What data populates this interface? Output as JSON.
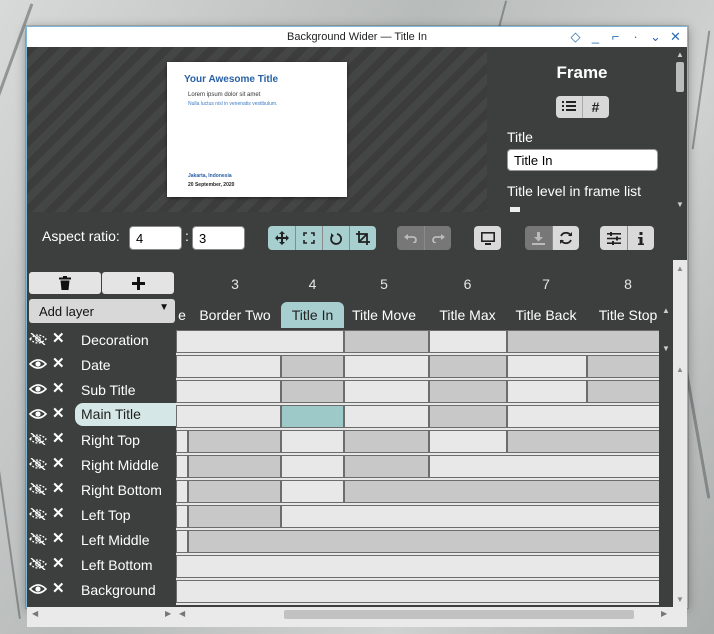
{
  "window": {
    "title": "Background Wider — Title In"
  },
  "wm_buttons": [
    {
      "name": "shade-icon",
      "glyph": "◇"
    },
    {
      "name": "minimize-icon",
      "glyph": "_"
    },
    {
      "name": "maximize-icon",
      "glyph": "⌐"
    },
    {
      "name": "sticky-icon",
      "glyph": "·"
    },
    {
      "name": "chevron-down-icon",
      "glyph": "⌄"
    },
    {
      "name": "close-icon",
      "glyph": "✕"
    }
  ],
  "slide": {
    "title": "Your Awesome Title",
    "subtitle": "Lorem ipsum dolor sit amet",
    "subtitle2": "Nulla luctus nisl in venenatis vestibulum.",
    "location": "Jakarta, Indonesia",
    "date": "20 September, 2020"
  },
  "frame_panel": {
    "heading": "Frame",
    "title_label": "Title",
    "title_value": "Title In",
    "level_label": "Title level in frame list"
  },
  "toolbar": {
    "aspect_label": "Aspect ratio:",
    "aspect_w": "4",
    "aspect_h": "3",
    "colon": ":"
  },
  "layers_panel": {
    "add_layer_label": "Add layer"
  },
  "layers": [
    {
      "name": "Decoration",
      "visible": false
    },
    {
      "name": "Date",
      "visible": true
    },
    {
      "name": "Sub Title",
      "visible": true
    },
    {
      "name": "Main Title",
      "visible": true,
      "selected": true
    },
    {
      "name": "Right Top",
      "visible": false
    },
    {
      "name": "Right Middle",
      "visible": false
    },
    {
      "name": "Right Bottom",
      "visible": false
    },
    {
      "name": "Left Top",
      "visible": false
    },
    {
      "name": "Left Middle",
      "visible": false
    },
    {
      "name": "Left Bottom",
      "visible": false
    },
    {
      "name": "Background",
      "visible": true
    }
  ],
  "frames": [
    {
      "num": "",
      "name": "e"
    },
    {
      "num": "3",
      "name": "Border Two"
    },
    {
      "num": "4",
      "name": "Title In",
      "selected": true
    },
    {
      "num": "5",
      "name": "Title Move"
    },
    {
      "num": "6",
      "name": "Title Max"
    },
    {
      "num": "7",
      "name": "Title Back"
    },
    {
      "num": "8",
      "name": "Title Stop"
    }
  ]
}
